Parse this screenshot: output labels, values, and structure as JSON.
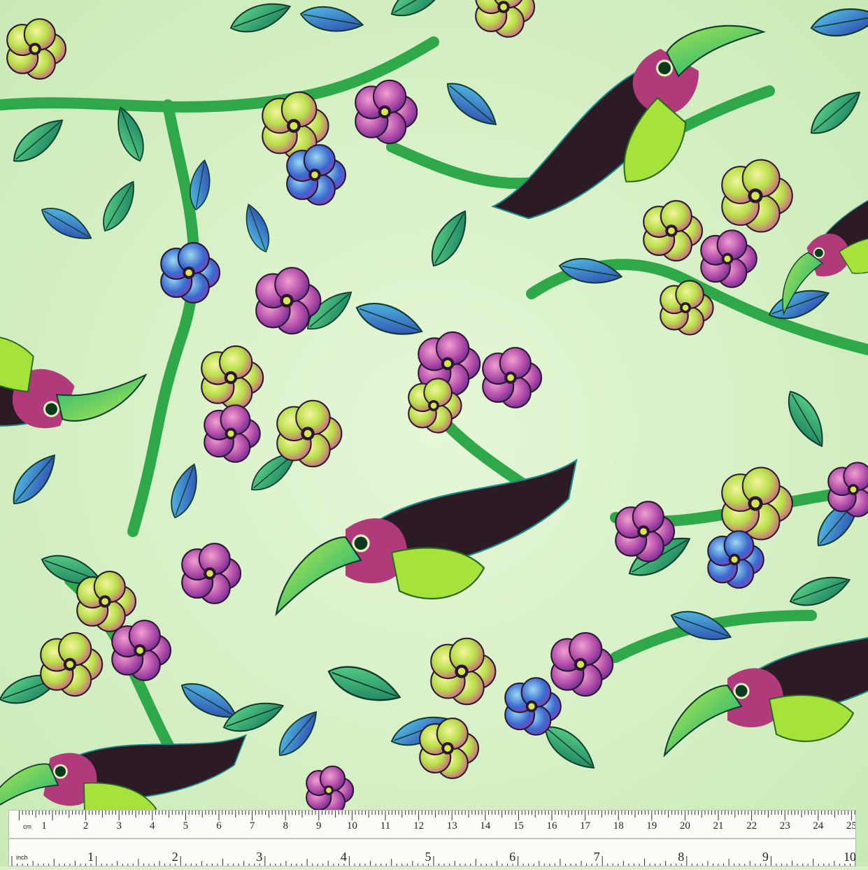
{
  "fabric": {
    "background_color": "#d9f0c8",
    "motif_colors": [
      "#2c1b24",
      "#8ed63a",
      "#a83a9a",
      "#2b5fc8",
      "#1f9a5a",
      "#e05a8a",
      "#c6e64a"
    ],
    "motifs": [
      "toucan",
      "flower",
      "leaf",
      "branch"
    ]
  },
  "ruler": {
    "cm_unit": "cm",
    "inch_unit": "inch",
    "cm_labels": [
      "1",
      "2",
      "3",
      "4",
      "5",
      "6",
      "7",
      "8",
      "9",
      "10",
      "11",
      "12",
      "13",
      "14",
      "15",
      "16",
      "17",
      "18",
      "19",
      "20",
      "21",
      "22",
      "23",
      "24",
      "25"
    ],
    "inch_labels": [
      "1",
      "2",
      "3",
      "4",
      "5",
      "6",
      "7",
      "8",
      "9",
      "10"
    ]
  }
}
